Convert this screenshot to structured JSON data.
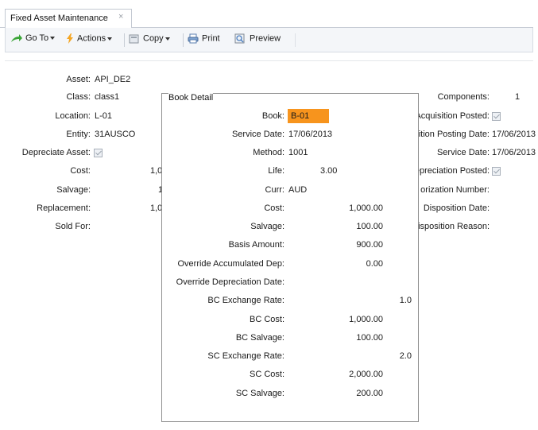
{
  "tab": {
    "title": "Fixed Asset Maintenance",
    "close": "×"
  },
  "toolbar": {
    "goto": "Go To",
    "actions": "Actions",
    "copy": "Copy",
    "print": "Print",
    "preview": "Preview"
  },
  "asset": {
    "asset_label": "Asset:",
    "asset_value": "API_DE2",
    "class_label": "Class:",
    "class_value": "class1",
    "location_label": "Location:",
    "location_value": "L-01",
    "entity_label": "Entity:",
    "entity_value": "31AUSCO",
    "depreciate_label": "Depreciate Asset:",
    "cost_label": "Cost:",
    "cost_value": "1,0",
    "salvage_label": "Salvage:",
    "salvage_value": "1",
    "replacement_label": "Replacement:",
    "replacement_value": "1,0",
    "soldfor_label": "Sold For:"
  },
  "right": {
    "components_label": "Components:",
    "components_value": "1",
    "acq_posted_label": "Acquisition Posted:",
    "acq_posting_date_label": "ition Posting Date:",
    "acq_posting_date_value": "17/06/2013",
    "service_date_label": "Service Date:",
    "service_date_value": "17/06/2013",
    "dep_posted_label": "epreciation Posted:",
    "auth_number_label": "orization Number:",
    "disposition_date_label": "Disposition Date:",
    "disposition_reason_label": "isposition Reason:"
  },
  "book_detail": {
    "title": "Book Detail",
    "book_label": "Book:",
    "book_value": "B-01",
    "service_date_label": "Service Date:",
    "service_date_value": "17/06/2013",
    "method_label": "Method:",
    "method_value": "1001",
    "life_label": "Life:",
    "life_value": "3.00",
    "curr_label": "Curr:",
    "curr_value": "AUD",
    "cost_label": "Cost:",
    "cost_value": "1,000.00",
    "salvage_label": "Salvage:",
    "salvage_value": "100.00",
    "basis_label": "Basis Amount:",
    "basis_value": "900.00",
    "override_acc_label": "Override Accumulated Dep:",
    "override_acc_value": "0.00",
    "override_date_label": "Override Depreciation Date:",
    "bc_rate_label": "BC Exchange Rate:",
    "bc_rate_value": "1.0",
    "bc_cost_label": "BC Cost:",
    "bc_cost_value": "1,000.00",
    "bc_salvage_label": "BC Salvage:",
    "bc_salvage_value": "100.00",
    "sc_rate_label": "SC Exchange Rate:",
    "sc_rate_value": "2.0",
    "sc_cost_label": "SC Cost:",
    "sc_cost_value": "2,000.00",
    "sc_salvage_label": "SC Salvage:",
    "sc_salvage_value": "200.00"
  },
  "colors": {
    "accent": "#f7941d",
    "border": "#8f8f8f",
    "toolbar_bg": "#f4f6f9"
  }
}
